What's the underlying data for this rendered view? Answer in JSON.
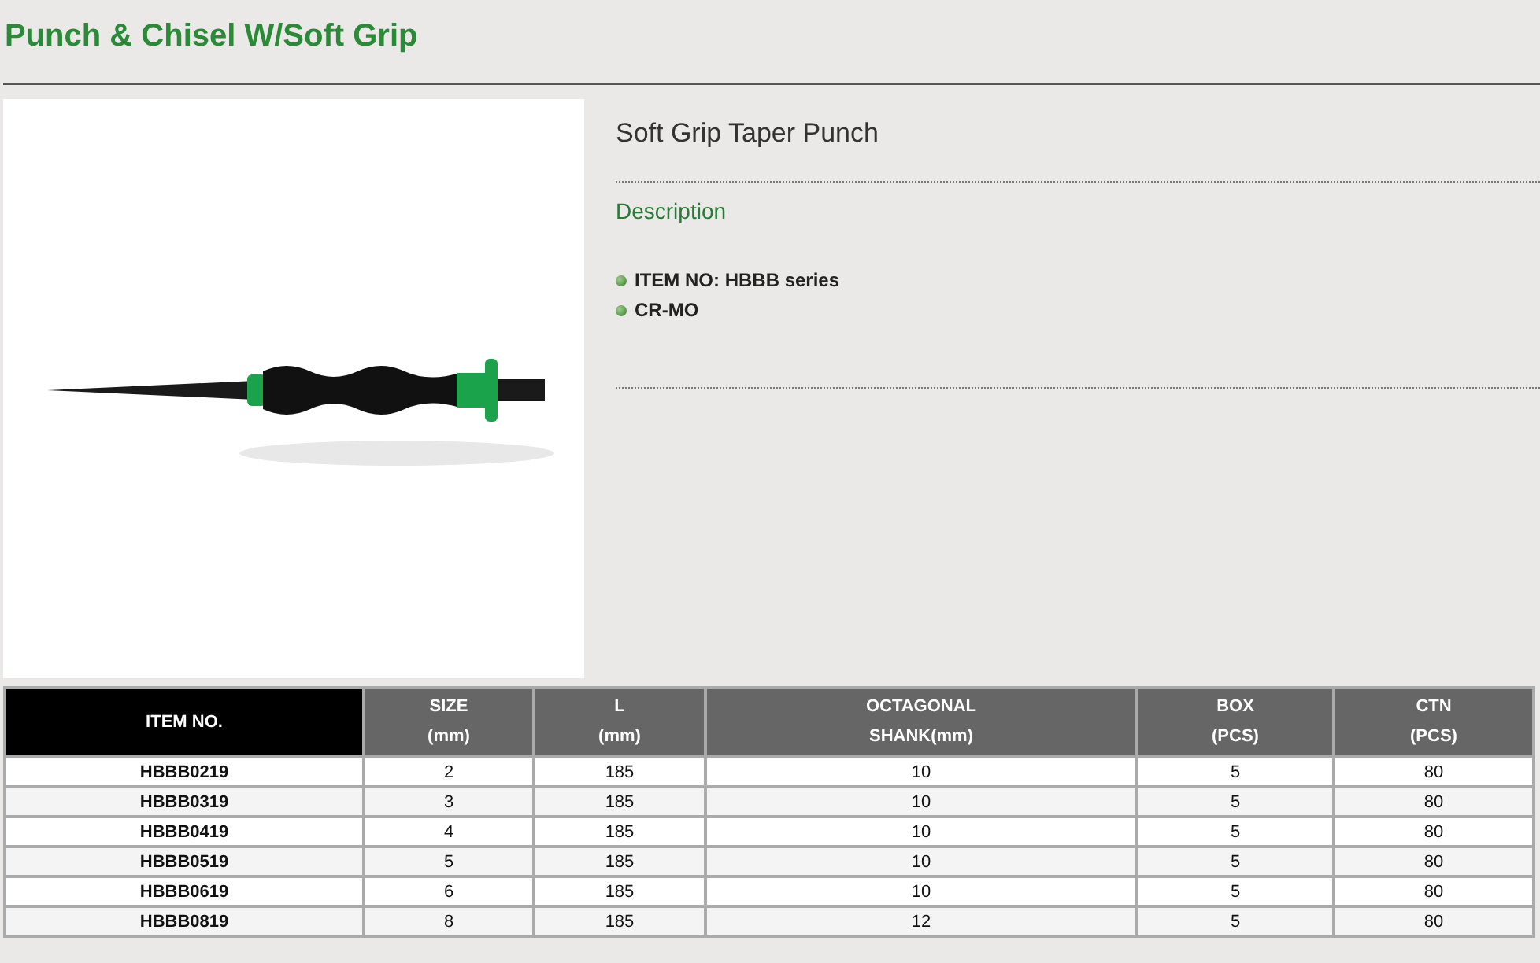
{
  "page_title": "Punch & Chisel W/Soft Grip",
  "product": {
    "name": "Soft Grip Taper Punch",
    "section": "Description",
    "features": [
      "ITEM NO: HBBB series",
      "CR-MO"
    ]
  },
  "table": {
    "columns": [
      {
        "label": "ITEM NO.",
        "kind": "key"
      },
      {
        "label": "SIZE\n(mm)",
        "kind": "plain"
      },
      {
        "label": "L\n(mm)",
        "kind": "plain"
      },
      {
        "label": "OCTAGONAL\nSHANK(mm)",
        "kind": "plain"
      },
      {
        "label": "BOX\n(PCS)",
        "kind": "plain"
      },
      {
        "label": "CTN\n(PCS)",
        "kind": "plain"
      }
    ],
    "rows": [
      [
        "HBBB0219",
        "2",
        "185",
        "10",
        "5",
        "80"
      ],
      [
        "HBBB0319",
        "3",
        "185",
        "10",
        "5",
        "80"
      ],
      [
        "HBBB0419",
        "4",
        "185",
        "10",
        "5",
        "80"
      ],
      [
        "HBBB0519",
        "5",
        "185",
        "10",
        "5",
        "80"
      ],
      [
        "HBBB0619",
        "6",
        "185",
        "10",
        "5",
        "80"
      ],
      [
        "HBBB0819",
        "8",
        "185",
        "12",
        "5",
        "80"
      ]
    ]
  }
}
